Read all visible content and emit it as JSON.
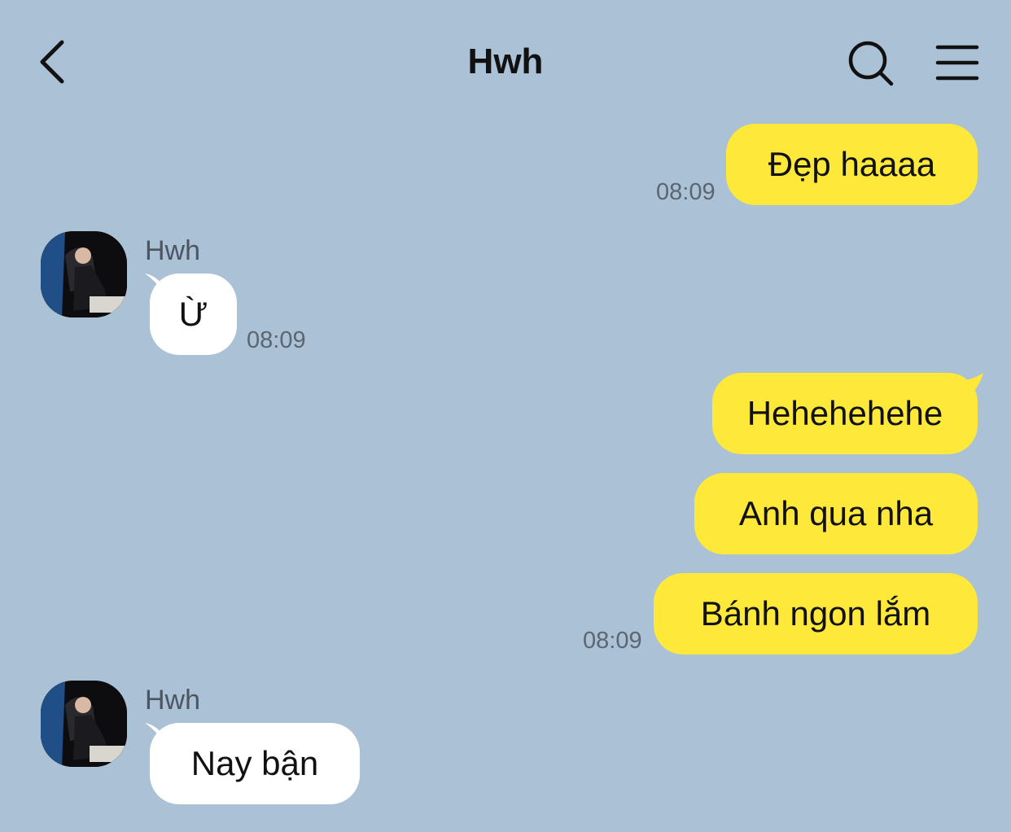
{
  "header": {
    "title": "Hwh",
    "back_icon": "chevron-left-icon",
    "search_icon": "search-icon",
    "menu_icon": "menu-icon"
  },
  "colors": {
    "background": "#abc1d6",
    "outgoing_bubble": "#fee83a",
    "incoming_bubble": "#ffffff"
  },
  "messages": [
    {
      "direction": "outgoing",
      "text": "Đẹp haaaa",
      "time": "08:09"
    },
    {
      "direction": "incoming",
      "sender": "Hwh",
      "text": "Ừ",
      "time": "08:09"
    },
    {
      "direction": "outgoing",
      "text": "Hehehehehe"
    },
    {
      "direction": "outgoing",
      "text": "Anh qua nha"
    },
    {
      "direction": "outgoing",
      "text": "Bánh ngon lắm",
      "time": "08:09"
    },
    {
      "direction": "incoming",
      "sender": "Hwh",
      "text": "Nay bận"
    }
  ]
}
